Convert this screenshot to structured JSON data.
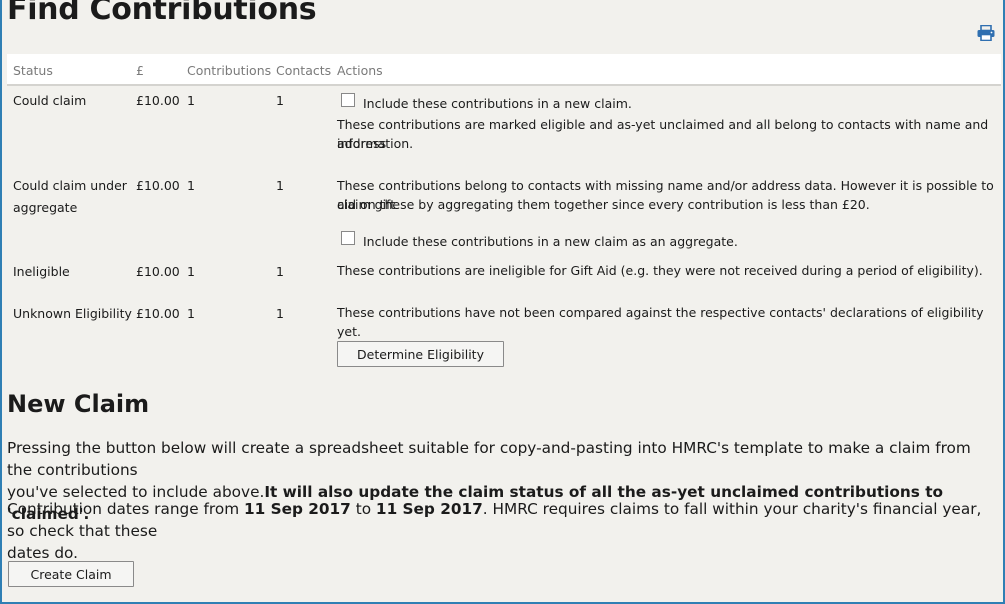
{
  "page": {
    "title": "Find Contributions"
  },
  "table": {
    "headers": {
      "status": "Status",
      "amount": "£",
      "contributions": "Contributions",
      "contacts": "Contacts",
      "actions": "Actions"
    },
    "rows": [
      {
        "status": "Could claim",
        "amount": "£10.00",
        "contributions": "1",
        "contacts": "1",
        "checkbox_label": "Include these contributions in a new claim.",
        "description_line1": "These contributions are marked eligible and as-yet unclaimed and all belong to contacts with name and address",
        "description_line2": "information."
      },
      {
        "status_line1": "Could claim under",
        "status_line2": "aggregate",
        "amount": "£10.00",
        "contributions": "1",
        "contacts": "1",
        "description_line1": "These contributions belong to contacts with missing name and/or address data. However it is possible to claim gift",
        "description_line2": "aid on these by aggregating them together since every contribution is less than £20.",
        "checkbox_label": "Include these contributions in a new claim as an aggregate."
      },
      {
        "status": "Ineligible",
        "amount": "£10.00",
        "contributions": "1",
        "contacts": "1",
        "description": "These contributions are ineligible for Gift Aid (e.g. they were not received during a period of eligibility)."
      },
      {
        "status": "Unknown Eligibility",
        "amount": "£10.00",
        "contributions": "1",
        "contacts": "1",
        "description": "These contributions have not been compared against the respective contacts' declarations of eligibility yet.",
        "button_label": "Determine Eligibility"
      }
    ]
  },
  "new_claim": {
    "heading": "New Claim",
    "intro_line1": "Pressing the button below will create a spreadsheet suitable for copy-and-pasting into HMRC's template to make a claim from the contributions",
    "intro_line2_plain": "you've selected to include above.",
    "intro_line2_bold": "It will also update the claim status of all the as-yet unclaimed contributions to 'claimed'.",
    "range_prefix": "Contribution dates range from ",
    "range_start": "11 Sep 2017",
    "range_mid": " to ",
    "range_end": "11 Sep 2017",
    "range_suffix": ". HMRC requires claims to fall within your charity's financial year, so check that these",
    "range_line2": "dates do.",
    "button_label": "Create Claim"
  },
  "colors": {
    "background": "#f2f1ed",
    "frame_border": "#2f7fb4",
    "print_icon": "#2f6fb0"
  },
  "icons": {
    "print": "printer-icon"
  }
}
